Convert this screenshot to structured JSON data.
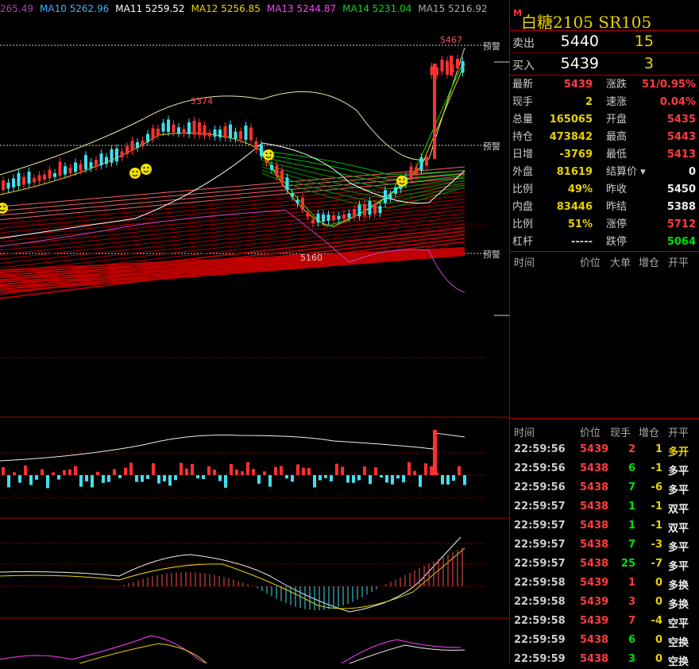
{
  "ma_header": [
    {
      "label": "265.49",
      "color": "#b040b0"
    },
    {
      "label": "MA10 5262.96",
      "color": "#40b0ff"
    },
    {
      "label": "MA11 5259.52",
      "color": "#ffffff"
    },
    {
      "label": "MA12 5256.85",
      "color": "#e8d200"
    },
    {
      "label": "MA13 5244.87",
      "color": "#ff40ff"
    },
    {
      "label": "MA14 5231.04",
      "color": "#00e000"
    },
    {
      "label": "MA15 5216.92",
      "color": "#aaaaaa"
    }
  ],
  "chart": {
    "high_label": "5467",
    "low_label": "5160",
    "high_label_2": "5374",
    "alert_label": "预警",
    "price_min": 5080,
    "price_max": 5480
  },
  "quote": {
    "marker": "M",
    "name": "白糖2105  SR105",
    "sell_label": "卖出",
    "sell_price": "5440",
    "sell_vol": "15",
    "buy_label": "买入",
    "buy_price": "5439",
    "buy_vol": "3"
  },
  "stats_left": [
    {
      "k": "最新",
      "v": "5439",
      "c": "red"
    },
    {
      "k": "现手",
      "v": "2",
      "c": "yel"
    },
    {
      "k": "总量",
      "v": "165065",
      "c": "yel"
    },
    {
      "k": "持仓",
      "v": "473842",
      "c": "yel"
    },
    {
      "k": "日增",
      "v": "-3769",
      "c": "yel"
    },
    {
      "k": "外盘",
      "v": "81619",
      "c": "yel"
    },
    {
      "k": "比例",
      "v": "49%",
      "c": "yel"
    },
    {
      "k": "内盘",
      "v": "83446",
      "c": "yel"
    },
    {
      "k": "比例",
      "v": "51%",
      "c": "yel"
    },
    {
      "k": "杠杆",
      "v": "-----",
      "c": "gry"
    }
  ],
  "stats_right": [
    {
      "k": "涨跌",
      "v": "51/0.95%",
      "c": "red"
    },
    {
      "k": "速涨",
      "v": "0.04%",
      "c": "red"
    },
    {
      "k": "开盘",
      "v": "5435",
      "c": "red"
    },
    {
      "k": "最高",
      "v": "5443",
      "c": "red"
    },
    {
      "k": "最低",
      "v": "5413",
      "c": "red"
    },
    {
      "k": "结算价",
      "v": "0",
      "c": "wht"
    },
    {
      "k": "昨收",
      "v": "5450",
      "c": "wht"
    },
    {
      "k": "昨结",
      "v": "5388",
      "c": "wht"
    },
    {
      "k": "涨停",
      "v": "5712",
      "c": "red"
    },
    {
      "k": "跌停",
      "v": "5064",
      "c": "grn"
    }
  ],
  "big_header": {
    "time": "时间",
    "price": "价位",
    "big": "大单",
    "inc": "增仓",
    "oc": "开平"
  },
  "tick_header": {
    "time": "时间",
    "price": "价位",
    "hand": "现手",
    "inc": "增仓",
    "oc": "开平"
  },
  "ticks": [
    {
      "time": "22:59:56",
      "price": "5439",
      "pc": "red",
      "hand": "2",
      "hc": "red",
      "inc": "1",
      "ic": "yel",
      "oc": "多开",
      "occ": "yel"
    },
    {
      "time": "22:59:56",
      "price": "5438",
      "pc": "red",
      "hand": "6",
      "hc": "grn",
      "inc": "-1",
      "ic": "yel",
      "oc": "多平",
      "occ": "wht"
    },
    {
      "time": "22:59:56",
      "price": "5438",
      "pc": "red",
      "hand": "7",
      "hc": "grn",
      "inc": "-6",
      "ic": "yel",
      "oc": "多平",
      "occ": "wht"
    },
    {
      "time": "22:59:57",
      "price": "5438",
      "pc": "red",
      "hand": "1",
      "hc": "grn",
      "inc": "-1",
      "ic": "yel",
      "oc": "双平",
      "occ": "wht"
    },
    {
      "time": "22:59:57",
      "price": "5438",
      "pc": "red",
      "hand": "1",
      "hc": "grn",
      "inc": "-1",
      "ic": "yel",
      "oc": "双平",
      "occ": "wht"
    },
    {
      "time": "22:59:57",
      "price": "5438",
      "pc": "red",
      "hand": "7",
      "hc": "grn",
      "inc": "-3",
      "ic": "yel",
      "oc": "多平",
      "occ": "wht"
    },
    {
      "time": "22:59:57",
      "price": "5438",
      "pc": "red",
      "hand": "25",
      "hc": "grn",
      "inc": "-7",
      "ic": "yel",
      "oc": "多平",
      "occ": "wht"
    },
    {
      "time": "22:59:58",
      "price": "5439",
      "pc": "red",
      "hand": "1",
      "hc": "red",
      "inc": "0",
      "ic": "yel",
      "oc": "多换",
      "occ": "wht"
    },
    {
      "time": "22:59:58",
      "price": "5439",
      "pc": "red",
      "hand": "3",
      "hc": "red",
      "inc": "0",
      "ic": "yel",
      "oc": "多换",
      "occ": "wht"
    },
    {
      "time": "22:59:58",
      "price": "5439",
      "pc": "red",
      "hand": "7",
      "hc": "red",
      "inc": "-4",
      "ic": "yel",
      "oc": "空平",
      "occ": "wht"
    },
    {
      "time": "22:59:59",
      "price": "5438",
      "pc": "red",
      "hand": "6",
      "hc": "grn",
      "inc": "0",
      "ic": "yel",
      "oc": "空换",
      "occ": "wht"
    },
    {
      "time": "22:59:59",
      "price": "5438",
      "pc": "red",
      "hand": "3",
      "hc": "grn",
      "inc": "0",
      "ic": "yel",
      "oc": "空换",
      "occ": "wht"
    }
  ]
}
